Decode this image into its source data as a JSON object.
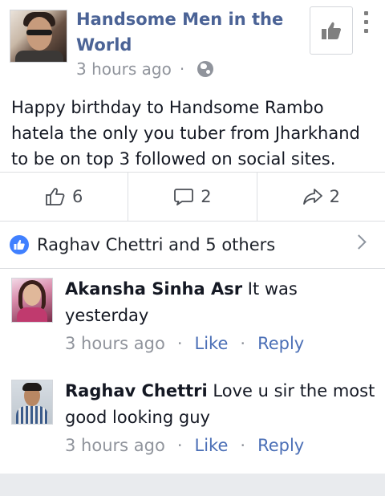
{
  "post": {
    "page_name": "Handsome Men in the World",
    "time": "3 hours ago",
    "separator": "·",
    "privacy_icon": "globe-icon",
    "text": "Happy birthday to Handsome Rambo hatela the only you tuber from Jharkhand to be on top 3 followed on social sites."
  },
  "actions": {
    "likes_count": "6",
    "comments_count": "2",
    "shares_count": "2"
  },
  "likes_summary": {
    "text": "Raghav Chettri and 5 others"
  },
  "comments": [
    {
      "author": "Akansha Sinha Asr",
      "text": "It was yesterday",
      "time": "3 hours ago",
      "like_label": "Like",
      "reply_label": "Reply"
    },
    {
      "author": "Raghav Chettri",
      "text": "Love u sir the most good looking guy",
      "time": "3 hours ago",
      "like_label": "Like",
      "reply_label": "Reply"
    }
  ],
  "colors": {
    "link": "#4b6fb6",
    "page_name": "#4b6396",
    "muted": "#90949c",
    "like_badge": "#4080ff"
  }
}
